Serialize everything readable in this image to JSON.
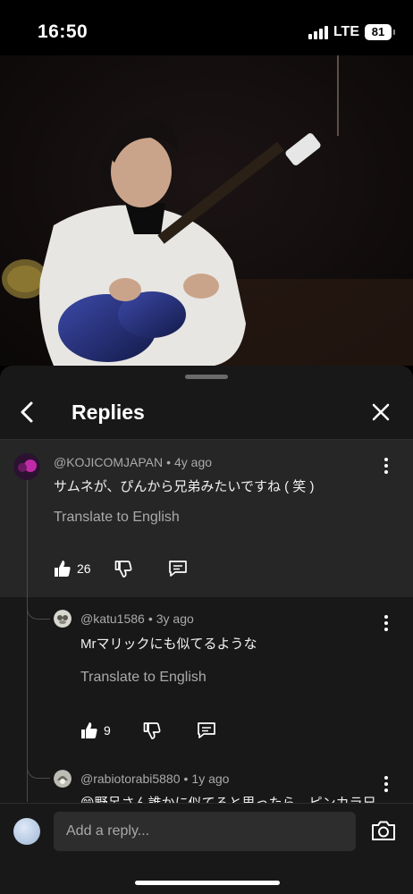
{
  "status_bar": {
    "time": "16:50",
    "network": "LTE",
    "battery": "81"
  },
  "sheet": {
    "title": "Replies"
  },
  "comments": [
    {
      "author": "@KOJICOMJAPAN",
      "age": "4y ago",
      "text": "サムネが、ぴんから兄弟みたいですね ( 笑 )",
      "translate": "Translate to English",
      "likes": "26"
    },
    {
      "author": "@katu1586",
      "age": "3y ago",
      "text": "Mrマリックにも似てるような",
      "translate": "Translate to English",
      "likes": "9"
    },
    {
      "author": "@rabiotorabi5880",
      "age": "1y ago",
      "text": "😄野呂さん誰かに似てると思ったら、ピンカラ兄"
    }
  ],
  "composer": {
    "placeholder": "Add a reply..."
  },
  "colors": {
    "background": "#000000",
    "sheet": "#181818",
    "highlight": "#262626",
    "secondary_text": "#aaaaaa"
  },
  "icons": [
    "back-arrow-icon",
    "close-icon",
    "thumbs-up-icon",
    "thumbs-down-icon",
    "reply-icon",
    "more-vert-icon",
    "camera-icon"
  ]
}
